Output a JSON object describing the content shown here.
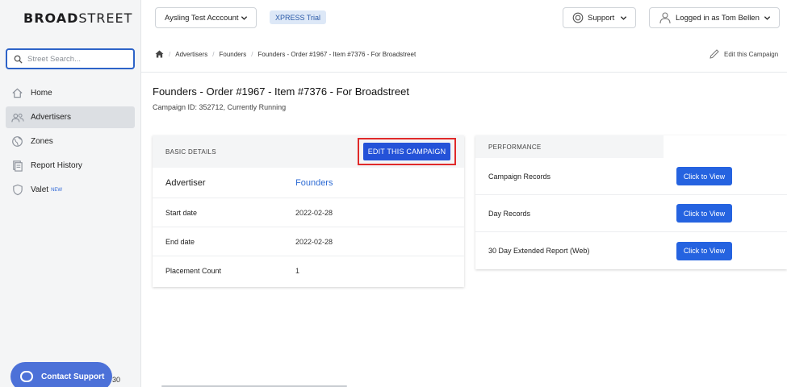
{
  "brand": {
    "bold": "BROAD",
    "light": "STREET"
  },
  "search": {
    "placeholder": "Street Search..."
  },
  "sidebar": {
    "items": [
      {
        "label": "Home",
        "icon": "home-icon"
      },
      {
        "label": "Advertisers",
        "icon": "users-icon",
        "active": true
      },
      {
        "label": "Zones",
        "icon": "globe-icon"
      },
      {
        "label": "Report History",
        "icon": "report-icon"
      },
      {
        "label": "Valet",
        "icon": "shield-icon",
        "badge": "NEW"
      }
    ],
    "contact_label": "Contact Support",
    "bottom_number": "30"
  },
  "header": {
    "account": "Aysling Test Acccount",
    "plan_badge": "XPRESS Trial",
    "support_label": "Support",
    "user_label": "Logged in as Tom Bellen"
  },
  "breadcrumb": {
    "items": [
      "Advertisers",
      "Founders",
      "Founders - Order #1967 - Item #7376 - For Broadstreet"
    ],
    "edit_link": "Edit this Campaign"
  },
  "page": {
    "title": "Founders - Order #1967 - Item #7376 - For Broadstreet",
    "subtitle": "Campaign ID: 352712, Currently Running"
  },
  "basic": {
    "header": "BASIC DETAILS",
    "edit_button": "EDIT THIS CAMPAIGN",
    "rows": [
      {
        "label": "Advertiser",
        "value": "Founders"
      },
      {
        "label": "Start date",
        "value": "2022-02-28"
      },
      {
        "label": "End date",
        "value": "2022-02-28"
      },
      {
        "label": "Placement Count",
        "value": "1"
      }
    ]
  },
  "performance": {
    "header": "PERFORMANCE",
    "rows": [
      {
        "label": "Campaign Records",
        "button": "Click to View"
      },
      {
        "label": "Day Records",
        "button": "Click to View"
      },
      {
        "label": "30 Day Extended Report (Web)",
        "button": "Click to View"
      }
    ]
  },
  "colors": {
    "primary": "#2452d8",
    "highlight": "#e02a2a",
    "link": "#2d6bd4"
  }
}
